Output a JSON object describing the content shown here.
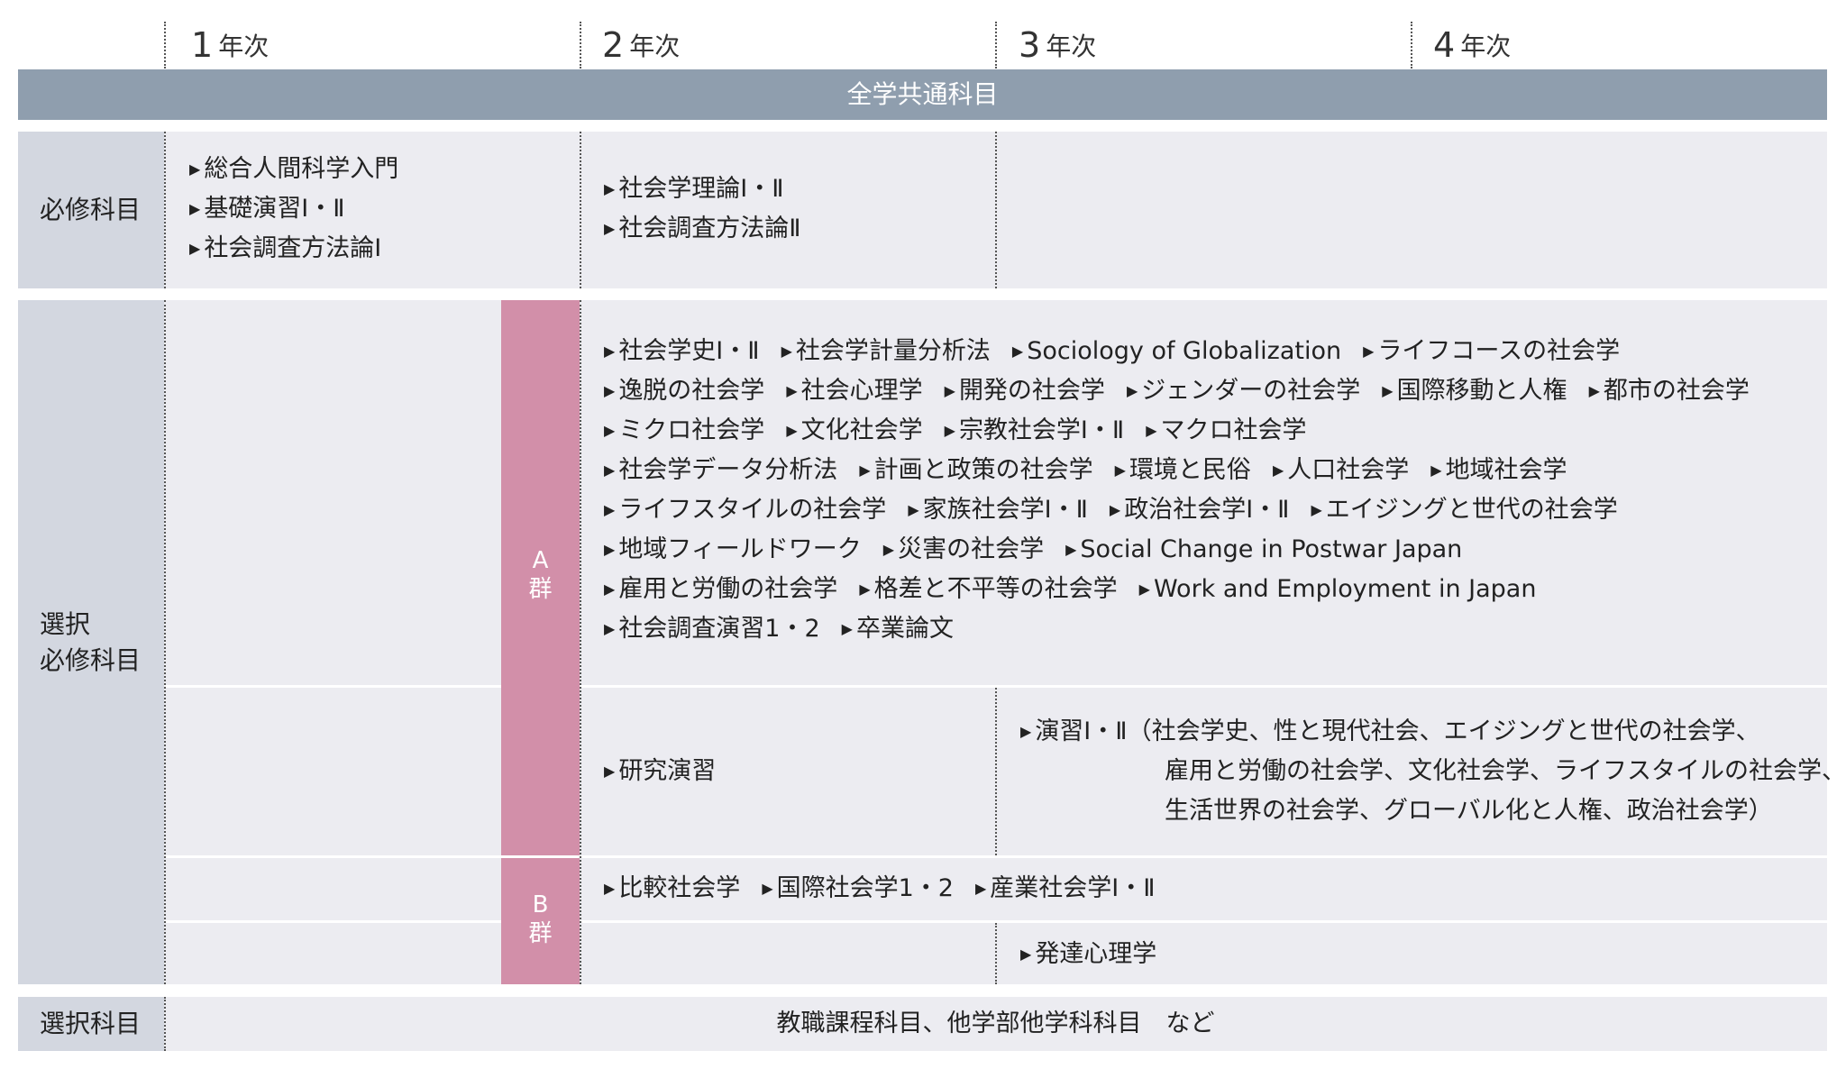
{
  "years": [
    "1",
    "2",
    "3",
    "4"
  ],
  "year_suffix": "年次",
  "header": {
    "common": "全学共通科目"
  },
  "required": {
    "label": "必修科目",
    "year1": [
      "総合人間科学入門",
      "基礎演習Ⅰ・Ⅱ",
      "社会調査方法論Ⅰ"
    ],
    "year2": [
      "社会学理論Ⅰ・Ⅱ",
      "社会調査方法論Ⅱ"
    ]
  },
  "elective_required": {
    "label_line1": "選択",
    "label_line2": "必修科目",
    "group_a": {
      "letter": "A",
      "name": "群"
    },
    "group_b": {
      "letter": "B",
      "name": "群"
    },
    "a_rows": [
      [
        "社会学史Ⅰ・Ⅱ",
        "社会学計量分析法",
        "Sociology of Globalization",
        "ライフコースの社会学"
      ],
      [
        "逸脱の社会学",
        "社会心理学",
        "開発の社会学",
        "ジェンダーの社会学",
        "国際移動と人権",
        "都市の社会学"
      ],
      [
        "ミクロ社会学",
        "文化社会学",
        "宗教社会学Ⅰ・Ⅱ",
        "マクロ社会学"
      ],
      [
        "社会学データ分析法",
        "計画と政策の社会学",
        "環境と民俗",
        "人口社会学",
        "地域社会学"
      ],
      [
        "ライフスタイルの社会学",
        "家族社会学Ⅰ・Ⅱ",
        "政治社会学Ⅰ・Ⅱ",
        "エイジングと世代の社会学"
      ],
      [
        "地域フィールドワーク",
        "災害の社会学",
        "Social Change in Postwar Japan"
      ],
      [
        "雇用と労働の社会学",
        "格差と不平等の社会学",
        "Work and Employment in Japan"
      ],
      [
        "社会調査演習1・2",
        "卒業論文"
      ]
    ],
    "research_seminar": "研究演習",
    "seminar_line1": "演習Ⅰ・Ⅱ（社会学史、性と現代社会、エイジングと世代の社会学、",
    "seminar_line2": "雇用と労働の社会学、文化社会学、ライフスタイルの社会学、",
    "seminar_line3": "生活世界の社会学、グローバル化と人権、政治社会学）",
    "b_row1": [
      "比較社会学",
      "国際社会学1・2",
      "産業社会学Ⅰ・Ⅱ"
    ],
    "b_row2": "発達心理学"
  },
  "electives": {
    "label": "選択科目",
    "content": "教職課程科目、他学部他学科科目　など"
  }
}
